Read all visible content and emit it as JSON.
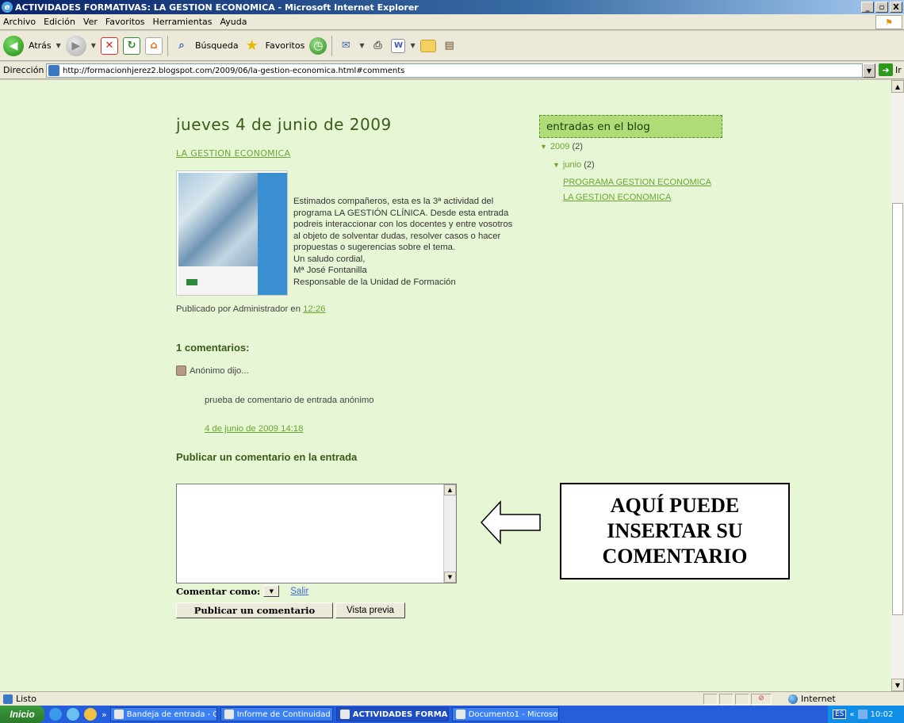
{
  "window": {
    "title": "ACTIVIDADES FORMATIVAS: LA GESTION ECONOMICA - Microsoft Internet Explorer",
    "min": "_",
    "max": "▫",
    "close": "X"
  },
  "menu": [
    "Archivo",
    "Edición",
    "Ver",
    "Favoritos",
    "Herramientas",
    "Ayuda"
  ],
  "toolbar": {
    "back": "Atrás",
    "search": "Búsqueda",
    "favorites": "Favoritos"
  },
  "address": {
    "label": "Dirección",
    "url": "http://formacionhjerez2.blogspot.com/2009/06/la-gestion-economica.html#comments",
    "go": "Ir"
  },
  "post": {
    "date": "jueves 4 de junio de 2009",
    "title": "LA GESTION ECONOMICA",
    "body": "Estimados compañeros, esta es la 3ª actividad del\nprograma LA GESTIÓN CLÍNICA. Desde esta entrada\npodreis interaccionar con los docentes y entre vosotros\nal objeto de solventar dudas, resolver casos o hacer\npropuestas o sugerencias sobre el tema.\nUn saludo cordial,\nMª José Fontanilla\nResponsable de la Unidad de Formación",
    "footer_prefix": "Publicado por Administrador en ",
    "time": "12:26"
  },
  "comments": {
    "header": "1 comentarios:",
    "author": "Anónimo dijo...",
    "body": "prueba de comentario de entrada anónimo",
    "date": "4 de junio de 2009 14:18"
  },
  "form": {
    "header": "Publicar un comentario en la entrada",
    "comment_as": "Comentar como:",
    "signout": "Salir",
    "publish": "Publicar un comentario",
    "preview": "Vista previa"
  },
  "callout": {
    "line1": "AQUÍ PUEDE",
    "line2": "INSERTAR SU",
    "line3": "COMENTARIO"
  },
  "sidebar": {
    "title": "entradas en el blog",
    "year": "2009",
    "year_count": "(2)",
    "month": "junio",
    "month_count": "(2)",
    "posts": [
      "PROGRAMA GESTION ECONOMICA",
      "LA GESTION ECONOMICA"
    ]
  },
  "status": {
    "text": "Listo",
    "zone": "Internet"
  },
  "taskbar": {
    "start": "Inicio",
    "chevron": "»",
    "tasks": [
      "Bandeja de entrada - Ou...",
      "Informe de Continuidad ...",
      "ACTIVIDADES FORMA...",
      "Documento1 - Microsoft ..."
    ],
    "lang": "ES",
    "tray_chevron": "«",
    "time": "10:02"
  }
}
